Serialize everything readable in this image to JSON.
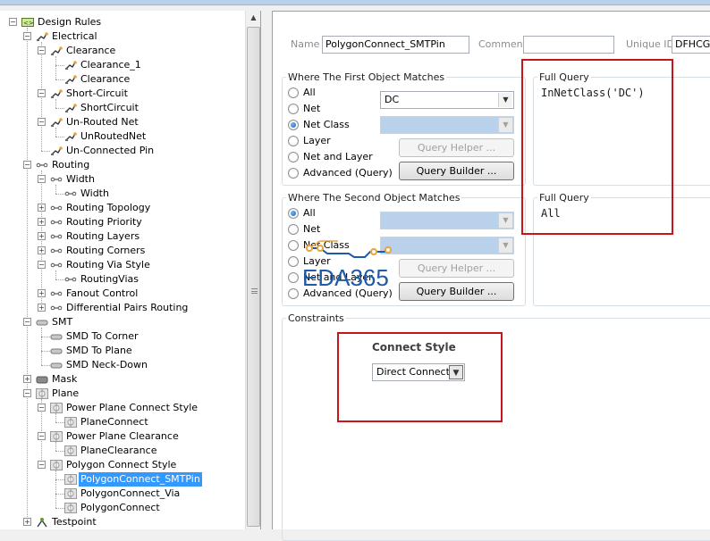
{
  "tree": {
    "items": [
      {
        "label": "Design Rules",
        "icon": "design-rules-icon",
        "expanded": true
      },
      {
        "label": "Electrical",
        "icon": "electrical-rule-icon",
        "expanded": true
      },
      {
        "label": "Clearance",
        "icon": "electrical-rule-icon",
        "expanded": true
      },
      {
        "label": "Clearance_1",
        "icon": "electrical-rule-icon"
      },
      {
        "label": "Clearance",
        "icon": "electrical-rule-icon"
      },
      {
        "label": "Short-Circuit",
        "icon": "electrical-rule-icon",
        "expanded": true
      },
      {
        "label": "ShortCircuit",
        "icon": "electrical-rule-icon"
      },
      {
        "label": "Un-Routed Net",
        "icon": "electrical-rule-icon",
        "expanded": true
      },
      {
        "label": "UnRoutedNet",
        "icon": "electrical-rule-icon"
      },
      {
        "label": "Un-Connected Pin",
        "icon": "electrical-rule-icon"
      },
      {
        "label": "Routing",
        "icon": "routing-rule-icon",
        "expanded": true
      },
      {
        "label": "Width",
        "icon": "routing-rule-icon",
        "expanded": true
      },
      {
        "label": "Width",
        "icon": "routing-rule-icon"
      },
      {
        "label": "Routing Topology",
        "icon": "routing-rule-icon",
        "expanded": false
      },
      {
        "label": "Routing Priority",
        "icon": "routing-rule-icon",
        "expanded": false
      },
      {
        "label": "Routing Layers",
        "icon": "routing-rule-icon",
        "expanded": false
      },
      {
        "label": "Routing Corners",
        "icon": "routing-rule-icon",
        "expanded": false
      },
      {
        "label": "Routing Via Style",
        "icon": "routing-rule-icon",
        "expanded": true
      },
      {
        "label": "RoutingVias",
        "icon": "routing-rule-icon"
      },
      {
        "label": "Fanout Control",
        "icon": "routing-rule-icon",
        "expanded": false
      },
      {
        "label": "Differential Pairs Routing",
        "icon": "routing-rule-icon",
        "expanded": false
      },
      {
        "label": "SMT",
        "icon": "smt-rule-icon",
        "expanded": true
      },
      {
        "label": "SMD To Corner",
        "icon": "smt-rule-icon"
      },
      {
        "label": "SMD To Plane",
        "icon": "smt-rule-icon"
      },
      {
        "label": "SMD Neck-Down",
        "icon": "smt-rule-icon"
      },
      {
        "label": "Mask",
        "icon": "mask-rule-icon",
        "expanded": false
      },
      {
        "label": "Plane",
        "icon": "plane-rule-icon",
        "expanded": true
      },
      {
        "label": "Power Plane Connect Style",
        "icon": "plane-rule-icon",
        "expanded": true
      },
      {
        "label": "PlaneConnect",
        "icon": "plane-rule-icon"
      },
      {
        "label": "Power Plane Clearance",
        "icon": "plane-rule-icon",
        "expanded": true
      },
      {
        "label": "PlaneClearance",
        "icon": "plane-rule-icon"
      },
      {
        "label": "Polygon Connect Style",
        "icon": "plane-rule-icon",
        "expanded": true
      },
      {
        "label": "PolygonConnect_SMTPin",
        "icon": "plane-rule-icon",
        "selected": true
      },
      {
        "label": "PolygonConnect_Via",
        "icon": "plane-rule-icon"
      },
      {
        "label": "PolygonConnect",
        "icon": "plane-rule-icon"
      },
      {
        "label": "Testpoint",
        "icon": "testpoint-rule-icon",
        "expanded": false
      }
    ]
  },
  "rule": {
    "name_label": "Name",
    "name_value": "PolygonConnect_SMTPin",
    "comment_label": "Comment",
    "comment_value": "",
    "unique_id_label": "Unique ID",
    "unique_id_value": "DFHCGI"
  },
  "first_match": {
    "title": "Where The First Object Matches",
    "options": [
      "All",
      "Net",
      "Net Class",
      "Layer",
      "Net and Layer",
      "Advanced (Query)"
    ],
    "selected_index": 2,
    "combo_value": "DC",
    "query_helper_label": "Query Helper ...",
    "query_builder_label": "Query Builder ...",
    "full_query_title": "Full Query",
    "full_query": "InNetClass('DC')"
  },
  "second_match": {
    "title": "Where The Second Object Matches",
    "options": [
      "All",
      "Net",
      "Net Class",
      "Layer",
      "Net and Layer",
      "Advanced (Query)"
    ],
    "selected_index": 0,
    "query_helper_label": "Query Helper ...",
    "query_builder_label": "Query Builder ...",
    "full_query_title": "Full Query",
    "full_query": "All"
  },
  "constraints": {
    "title": "Constraints",
    "connect_style_label": "Connect Style",
    "connect_style_value": "Direct Connect"
  },
  "watermark": {
    "text": "EDA365"
  },
  "colors": {
    "highlight": "#c8141b",
    "selection": "#3399ff",
    "watermark": "#1e5aa8",
    "disabled_combo": "#b9d1ea"
  }
}
